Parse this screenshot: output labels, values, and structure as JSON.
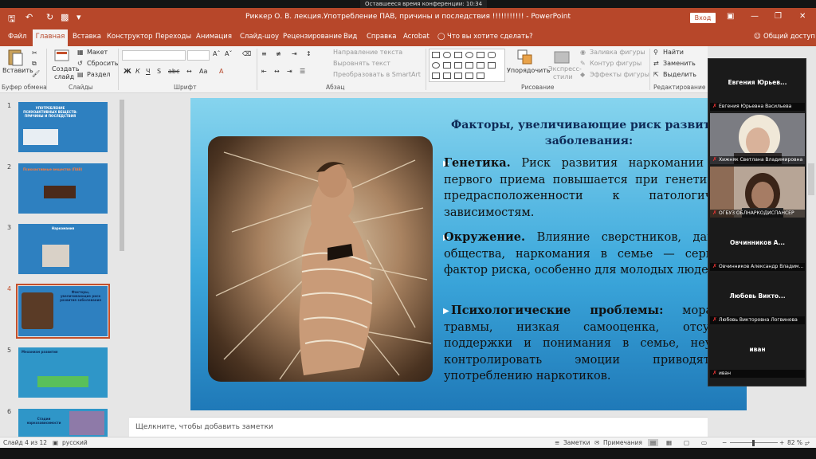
{
  "conference": {
    "time_label": "Оставшееся время конференции: 10:34"
  },
  "titlebar": {
    "title": "Риккер О. В. лекция.Употребление ПАВ, причины и последствия  !!!!!!!!!!!  -  PowerPoint",
    "login": "Вход"
  },
  "tabs": [
    "Файл",
    "Главная",
    "Вставка",
    "Конструктор",
    "Переходы",
    "Анимация",
    "Слайд-шоу",
    "Рецензирование",
    "Вид",
    "Справка",
    "Acrobat",
    "Что вы хотите сделать?"
  ],
  "share": "Общий доступ",
  "ribbon": {
    "paste": "Вставить",
    "clipboard": "Буфер обмена",
    "create_slide": [
      "Создать",
      "слайд"
    ],
    "layout": "Макет",
    "reset": "Сбросить",
    "section": "Раздел",
    "slides": "Слайды",
    "font": "Шрифт",
    "font_btns": [
      "Ж",
      "К",
      "Ч",
      "S",
      "abc"
    ],
    "text_dir": "Направление текста",
    "align_text": "Выровнять текст",
    "smartart": "Преобразовать в SmartArt",
    "paragraph": "Абзац",
    "arrange": "Упорядочить",
    "quick_styles": [
      "Экспресс-",
      "стили"
    ],
    "fill": "Заливка фигуры",
    "outline": "Контур фигуры",
    "effects": "Эффекты фигуры",
    "drawing": "Рисование",
    "find": "Найти",
    "replace": "Заменить",
    "select": "Выделить",
    "editing": "Редактирование"
  },
  "thumbs": [
    {
      "num": "1",
      "title": "УПОТРЕБЛЕНИЕ ПСИХОАКТИВНЫХ ВЕЩЕСТВ: ПРИЧИНЫ И ПОСЛЕДСТВИЯ"
    },
    {
      "num": "2",
      "title": "Психоактивные вещества (ПАВ)"
    },
    {
      "num": "3",
      "title": "Наркомания"
    },
    {
      "num": "4",
      "title": "Факторы, увеличивающие риск развития заболевания"
    },
    {
      "num": "5",
      "title": "Механизм развития"
    },
    {
      "num": "6",
      "title": "Стадии наркозависимости"
    }
  ],
  "slide": {
    "title": "Факторы, увеличивающие риск развития заболевания:",
    "items": [
      {
        "bold": "Генетика.",
        "text": " Риск развития наркомании после первого приема повышается при генетической предрасположенности к патологическим зависимостям."
      },
      {
        "bold": "Окружение.",
        "text": " Влияние сверстников, давление общества, наркомания в семье — серьезный фактор риска, особенно для молодых людей."
      },
      {
        "bold": "Психологические проблемы:",
        "text": " моральные травмы, низкая самооценка, отсутствие поддержки и понимания в семье, неумение контролировать эмоции приводят к употреблению наркотиков."
      }
    ]
  },
  "notes_placeholder": "Щелкните, чтобы добавить заметки",
  "status": {
    "slide": "Слайд 4 из 12",
    "lang": "русский",
    "notes": "Заметки",
    "comments": "Примечания",
    "zoom": "82 %"
  },
  "participants": [
    {
      "name": "Евгения  Юрьев...",
      "caption": "Евгения Юрьевна Васильева",
      "video": false
    },
    {
      "name": "",
      "caption": "Хижняк Светлана Владимировна",
      "video": true,
      "skin": "#d9b29a"
    },
    {
      "name": "",
      "caption": "ОГБУЗ ОБЛНАРКОДИСПАНСЕР",
      "video": true,
      "skin": "#a67c64"
    },
    {
      "name": "Овчинников  А...",
      "caption": "Овчинников Александр Владим...",
      "video": false
    },
    {
      "name": "Любовь  Викто...",
      "caption": "Любовь Викторовна Логвинова",
      "video": false
    },
    {
      "name": "иван",
      "caption": "иван",
      "video": false
    }
  ]
}
